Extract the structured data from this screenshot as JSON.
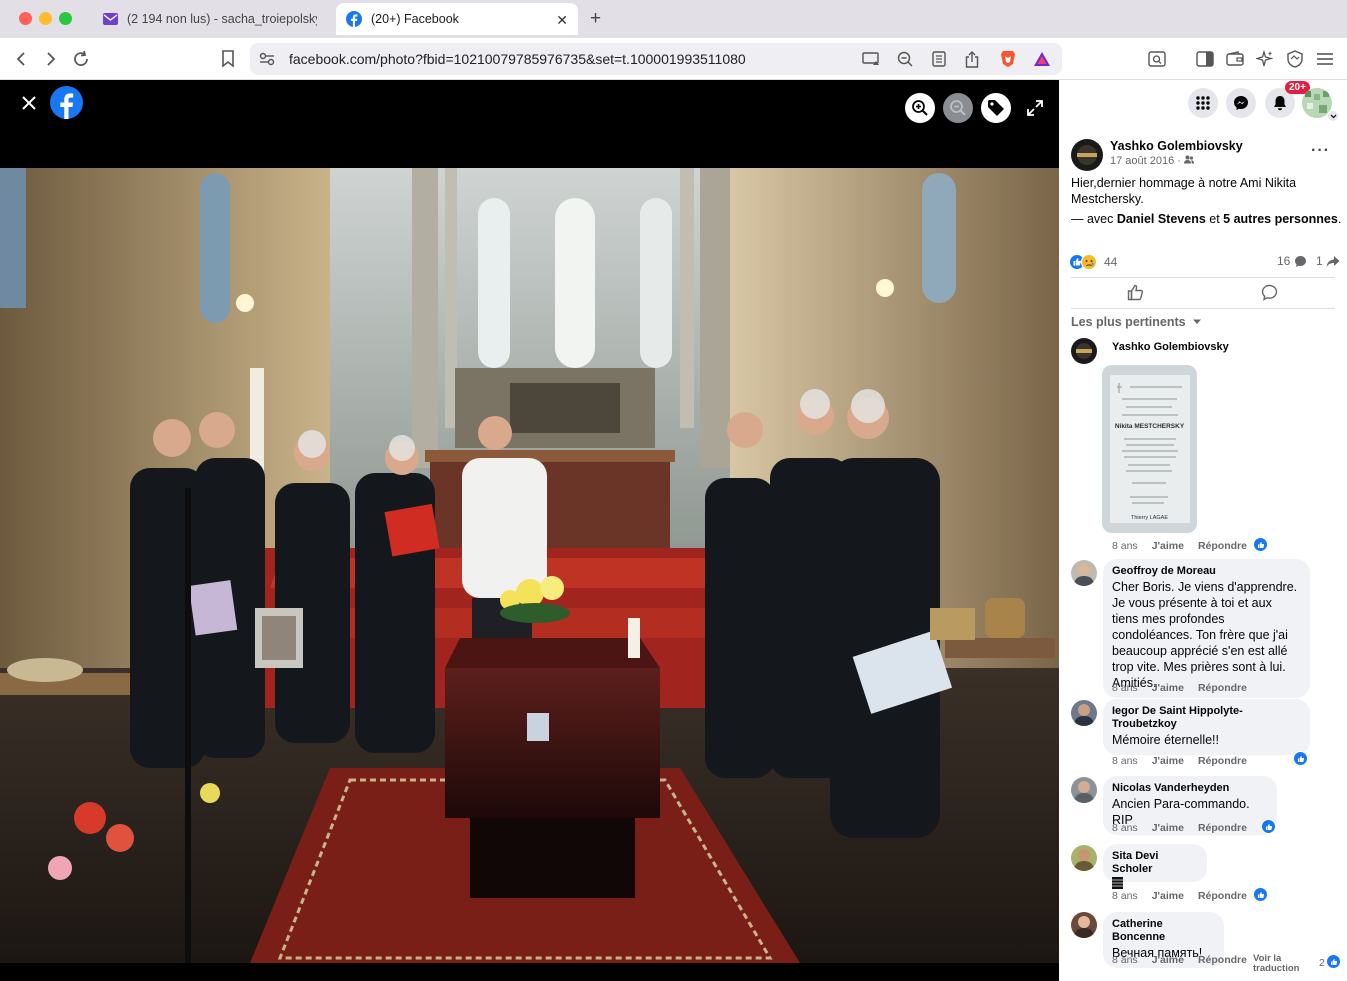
{
  "browser": {
    "tabs": [
      {
        "title": "(2 194 non lus) - sacha_troiepolsky",
        "active": false
      },
      {
        "title": "(20+) Facebook",
        "active": true
      }
    ],
    "url": "facebook.com/photo?fbid=10210079785976735&set=t.100001993511080"
  },
  "colors": {
    "facebook_blue": "#1877f2",
    "notification_red": "#e41e3f",
    "viewer_bg": "#000000"
  },
  "header": {
    "notification_badge": "20+"
  },
  "post": {
    "author": "Yashko Golembiovsky",
    "date": "17 août 2016",
    "date_sep": " · ",
    "text": "Hier,dernier hommage à notre Ami Nikita Mestchersky.",
    "with_prefix": "— avec ",
    "tagged_person": "Daniel Stevens",
    "and_word": " et ",
    "others": "5 autres personnes",
    "end": ".",
    "reactions_count": "44",
    "comments_count": "16",
    "shares_count": "1"
  },
  "comments_sort": "Les plus pertinents",
  "comments": [
    {
      "name": "Yashko Golembiovsky",
      "text": "",
      "age": "8 ans",
      "like": "J'aime",
      "reply": "Répondre"
    },
    {
      "name": "Geoffroy de Moreau",
      "text": "Cher Boris. Je viens d'apprendre. Je vous présente à toi et aux tiens mes profondes condoléances. Ton frère que j'ai beaucoup apprécié s'en est allé trop vite. Mes prières sont à lui. Amitiés.",
      "age": "8 ans",
      "like": "J'aime",
      "reply": "Répondre"
    },
    {
      "name": "Iegor De Saint Hippolyte-Troubetzkoy",
      "text": "Mémoire éternelle!!",
      "age": "8 ans",
      "like": "J'aime",
      "reply": "Répondre"
    },
    {
      "name": "Nicolas Vanderheyden",
      "text": "Ancien Para-commando. RIP",
      "age": "8 ans",
      "like": "J'aime",
      "reply": "Répondre"
    },
    {
      "name": "Sita Devi Scholer",
      "text": "",
      "age": "8 ans",
      "like": "J'aime",
      "reply": "Répondre"
    },
    {
      "name": "Catherine Boncenne",
      "text": "Вечная память!",
      "age": "8 ans",
      "like": "J'aime",
      "reply": "Répondre",
      "translate": "Voir la traduction",
      "reactions": "2"
    }
  ],
  "attachment_card": {
    "title": "Nikita MESTCHERSKY",
    "footer": "Thierry LAGAE"
  }
}
